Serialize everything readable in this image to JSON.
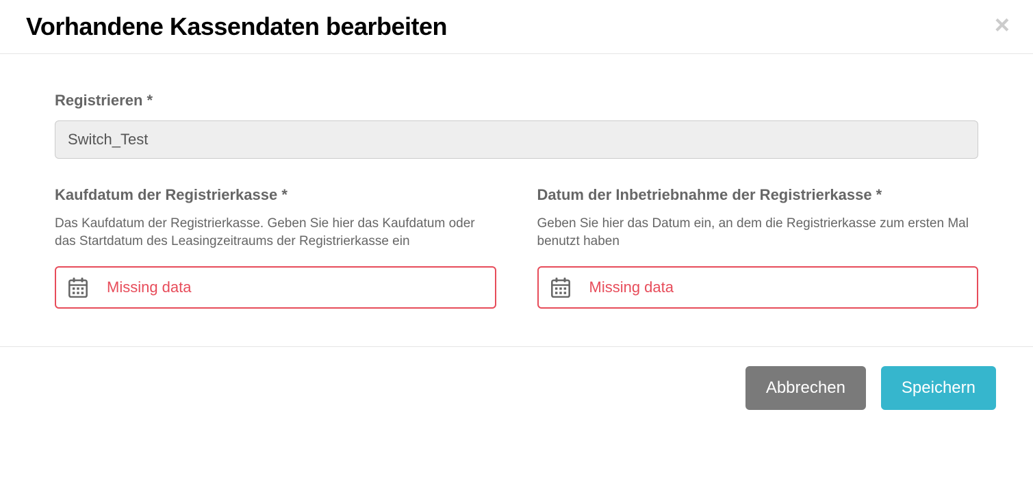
{
  "modal": {
    "title": "Vorhandene Kassendaten bearbeiten"
  },
  "fields": {
    "register": {
      "label": "Registrieren *",
      "value": "Switch_Test"
    },
    "purchase_date": {
      "label": "Kaufdatum der Registrierkasse *",
      "help": "Das Kaufdatum der Registrierkasse. Geben Sie hier das Kaufdatum oder das Startdatum des Leasingzeitraums der Registrierkasse ein",
      "placeholder": "Missing data"
    },
    "commissioning_date": {
      "label": "Datum der Inbetriebnahme der Registrierkasse *",
      "help": "Geben Sie hier das Datum ein, an dem die Registrierkasse zum ersten Mal benutzt haben",
      "placeholder": "Missing data"
    }
  },
  "footer": {
    "cancel_label": "Abbrechen",
    "save_label": "Speichern"
  }
}
